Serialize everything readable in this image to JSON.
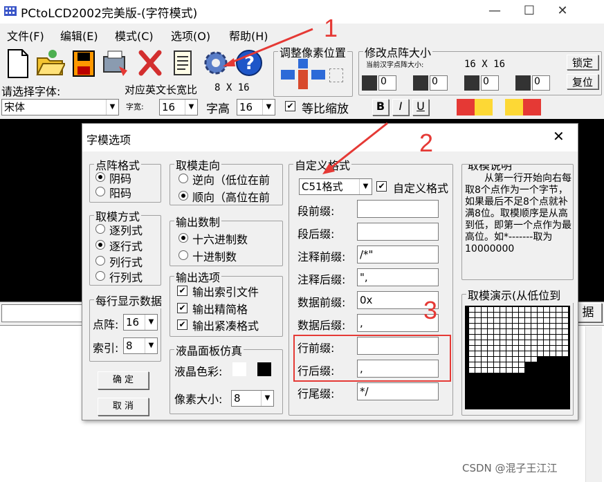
{
  "window": {
    "title": "PCtoLCD2002完美版-(字符模式)",
    "minimize": "—",
    "maximize": "☐",
    "close": "✕"
  },
  "menu": [
    "文件(F)",
    "编辑(E)",
    "模式(C)",
    "选项(O)",
    "帮助(H)"
  ],
  "font_panel": {
    "choose_font_label": "请选择字体:",
    "font_value": "宋体",
    "ratio_label": "对应英文长宽比",
    "ratio_value": "8 X 16",
    "width_label": "字宽:",
    "width_value": "16",
    "height_label": "字高",
    "height_value": "16",
    "proportional_label": "等比缩放",
    "bold": "B",
    "italic": "I",
    "underline": "U"
  },
  "pixel_panel": {
    "title": "调整像素位置"
  },
  "size_panel": {
    "title": "修改点阵大小",
    "current_label": "当前汉字点阵大小:",
    "current_value": "16 X 16",
    "lock": "锁定",
    "reset": "复位",
    "spins": [
      "0",
      "0",
      "0",
      "0"
    ]
  },
  "bg_button_right": "据",
  "dialog": {
    "title": "字模选项",
    "close": "✕",
    "dot_format": {
      "title": "点阵格式",
      "options": [
        "阴码",
        "阳码"
      ]
    },
    "mode": {
      "title": "取模方式",
      "options": [
        "逐列式",
        "逐行式",
        "列行式",
        "行列式"
      ]
    },
    "per_line": {
      "title": "每行显示数据",
      "dot_label": "点阵:",
      "dot_value": "16",
      "index_label": "索引:",
      "index_value": "8"
    },
    "confirm": "确 定",
    "cancel": "取 消",
    "direction": {
      "title": "取模走向",
      "options": [
        "逆向（低位在前",
        "顺向（高位在前"
      ]
    },
    "number": {
      "title": "输出数制",
      "options": [
        "十六进制数",
        "十进制数"
      ]
    },
    "output": {
      "title": "输出选项",
      "options": [
        "输出索引文件",
        "输出精简格",
        "输出紧凑格式"
      ]
    },
    "lcd": {
      "title": "液晶面板仿真",
      "color_label": "液晶色彩:",
      "pixel_label": "像素大小:",
      "pixel_value": "8"
    },
    "custom": {
      "title": "自定义格式",
      "format_value": "C51格式",
      "custom_check": "自定义格式",
      "fields": [
        {
          "label": "段前缀:",
          "value": ""
        },
        {
          "label": "段后缀:",
          "value": ""
        },
        {
          "label": "注释前缀:",
          "value": "/*\""
        },
        {
          "label": "注释后缀:",
          "value": "\","
        },
        {
          "label": "数据前缀:",
          "value": "0x"
        },
        {
          "label": "数据后缀:",
          "value": ","
        },
        {
          "label": "行前缀:",
          "value": ""
        },
        {
          "label": "行后缀:",
          "value": ","
        },
        {
          "label": "行尾缀:",
          "value": "*/"
        }
      ]
    },
    "description": {
      "title": "取模说明",
      "text": "从第一行开始向右每取8个点作为一个字节，如果最后不足8个点就补满8位。取模顺序是从高到低，即第一个点作为最高位。如*-------取为10000000"
    },
    "demo": {
      "title": "取模演示(从低位到"
    }
  },
  "annotations": [
    "1",
    "2",
    "3"
  ],
  "watermark": "CSDN @混子王江江",
  "colors": {
    "annot": "#e53935"
  }
}
